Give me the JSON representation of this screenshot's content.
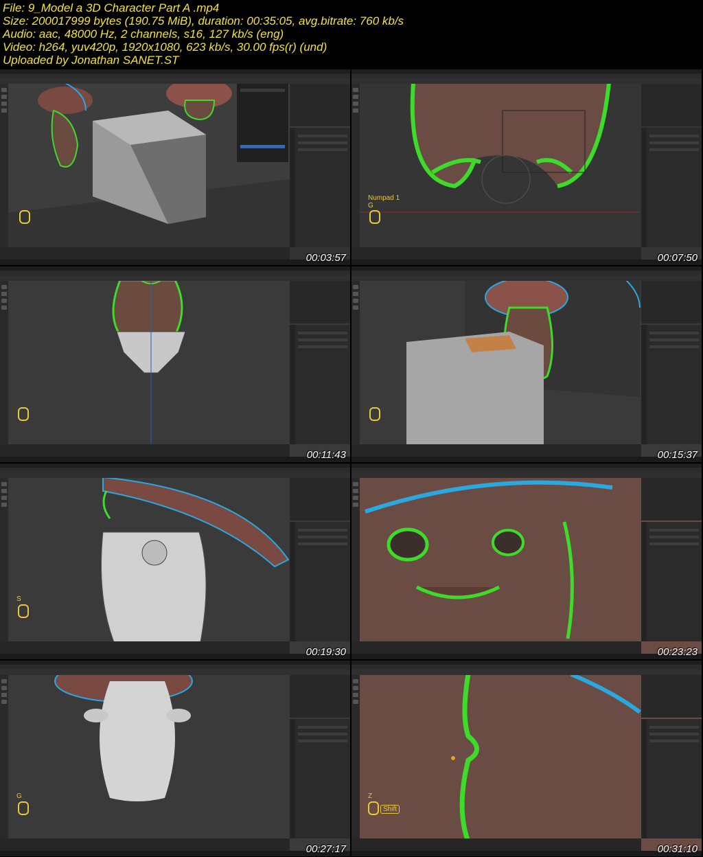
{
  "header": {
    "line1": "File: 9_Model a 3D Character Part A .mp4",
    "line2": "Size: 200017999 bytes (190.75 MiB), duration: 00:35:05, avg.bitrate: 760 kb/s",
    "line3": "Audio: aac, 48000 Hz, 2 channels, s16, 127 kb/s (eng)",
    "line4": "Video: h264, yuv420p, 1920x1080, 623 kb/s, 30.00 fps(r) (und)",
    "line5": "Uploaded by Jonathan SANET.ST"
  },
  "thumbnails": [
    {
      "timestamp": "00:03:57",
      "hint": ""
    },
    {
      "timestamp": "00:07:50",
      "hint": "Numpad 1\nG"
    },
    {
      "timestamp": "00:11:43",
      "hint": ""
    },
    {
      "timestamp": "00:15:37",
      "hint": ""
    },
    {
      "timestamp": "00:19:30",
      "hint": "S"
    },
    {
      "timestamp": "00:23:23",
      "hint": ""
    },
    {
      "timestamp": "00:27:17",
      "hint": "G"
    },
    {
      "timestamp": "00:31:10",
      "hint": "Z",
      "key": "Shift"
    }
  ],
  "colors": {
    "header_text": "#f2e23c",
    "outline_green": "#3ddc2a",
    "outline_blue": "#2aa8e0",
    "hint_yellow": "#e8c93a"
  }
}
